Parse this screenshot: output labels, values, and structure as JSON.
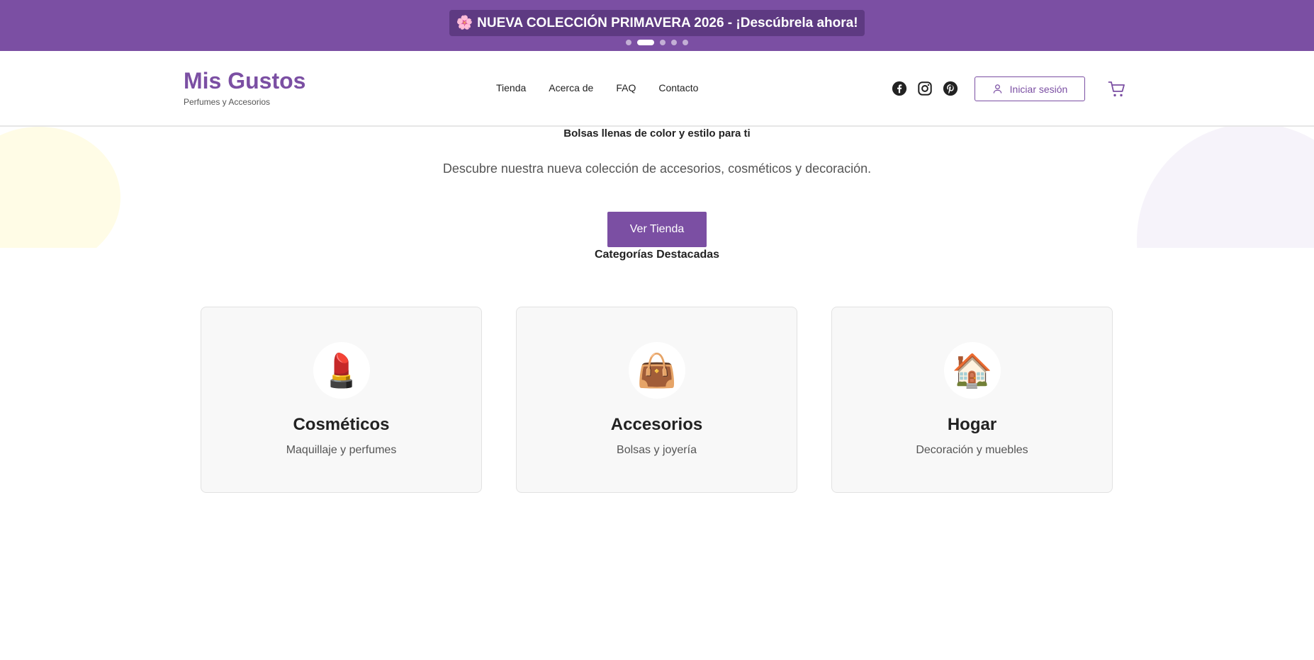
{
  "promo": {
    "emoji": "🌸",
    "text": "NUEVA COLECCIÓN PRIMAVERA 2026 - ¡Descúbrela ahora!",
    "slides": 5,
    "active_slide": 2
  },
  "header": {
    "brand_name": "Mis Gustos",
    "brand_tagline": "Perfumes y Accesorios",
    "nav": [
      "Tienda",
      "Acerca de",
      "FAQ",
      "Contacto"
    ],
    "socials": [
      "facebook-icon",
      "instagram-icon",
      "pinterest-icon"
    ],
    "login_label": "Iniciar sesión",
    "cart_icon": "cart-icon"
  },
  "hero": {
    "title": "Bolsas llenas de color y estilo para ti",
    "subtitle": "Descubre nuestra nueva colección de accesorios, cosméticos y decoración.",
    "cta_label": "Ver Tienda"
  },
  "categories": {
    "title": "Categorías Destacadas",
    "items": [
      {
        "icon": "💄",
        "name": "Cosméticos",
        "desc": "Maquillaje y perfumes"
      },
      {
        "icon": "👜",
        "name": "Accesorios",
        "desc": "Bolsas y joyería"
      },
      {
        "icon": "🏠",
        "name": "Hogar",
        "desc": "Decoración y muebles"
      }
    ]
  },
  "colors": {
    "brand": "#7b4fa3",
    "brand_dark": "#5e3a82",
    "card_bg": "#f8f8f8"
  }
}
